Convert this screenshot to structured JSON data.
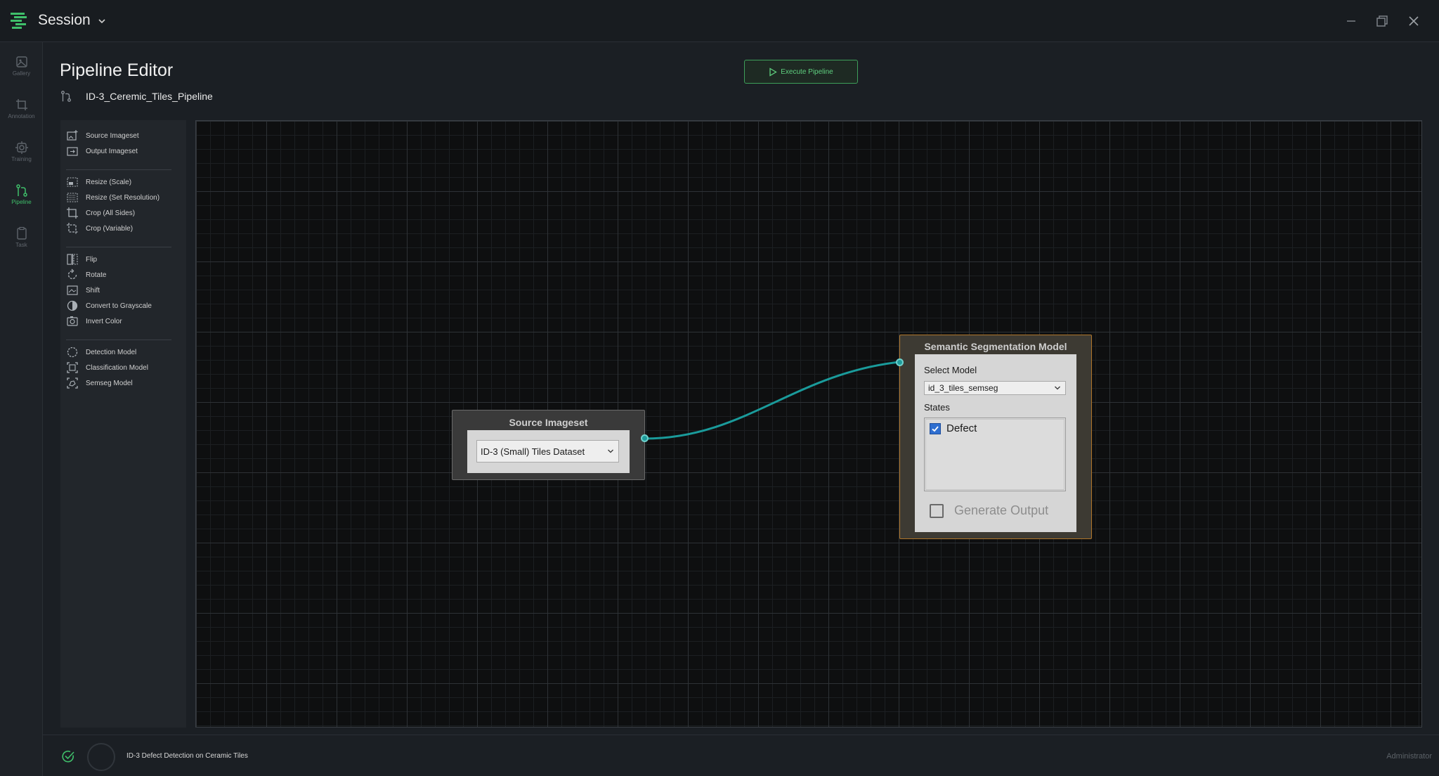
{
  "titlebar": {
    "session_label": "Session",
    "icons": [
      "app-logo",
      "chevron-down-icon",
      "minimize-icon",
      "restore-icon",
      "close-icon"
    ]
  },
  "nav_rail": {
    "items": [
      {
        "label": "Gallery",
        "icon": "gallery-icon",
        "active": false
      },
      {
        "label": "Annotation",
        "icon": "crop-icon",
        "active": false
      },
      {
        "label": "Training",
        "icon": "training-icon",
        "active": false
      },
      {
        "label": "Pipeline",
        "icon": "pipeline-icon",
        "active": true
      },
      {
        "label": "Task",
        "icon": "clipboard-icon",
        "active": false
      }
    ]
  },
  "header": {
    "title": "Pipeline Editor",
    "pipeline_name": "ID-3_Ceremic_Tiles_Pipeline",
    "execute_label": "Execute Pipeline"
  },
  "palette": {
    "items": [
      {
        "label": "Source Imageset",
        "icon": "image-plus-icon"
      },
      {
        "label": "Output Imageset",
        "icon": "image-out-icon"
      },
      {
        "label": "Resize (Scale)",
        "icon": "resize-scale-icon"
      },
      {
        "label": "Resize (Set Resolution)",
        "icon": "resize-resolution-icon"
      },
      {
        "label": "Crop (All Sides)",
        "icon": "crop-icon"
      },
      {
        "label": "Crop (Variable)",
        "icon": "crop-variable-icon"
      },
      {
        "label": "Flip",
        "icon": "flip-icon"
      },
      {
        "label": "Rotate",
        "icon": "rotate-icon"
      },
      {
        "label": "Shift",
        "icon": "shift-icon"
      },
      {
        "label": "Convert to Grayscale",
        "icon": "grayscale-icon"
      },
      {
        "label": "Invert Color",
        "icon": "invert-color-icon"
      },
      {
        "label": "Detection Model",
        "icon": "detection-icon"
      },
      {
        "label": "Classification Model",
        "icon": "classification-icon"
      },
      {
        "label": "Semseg Model",
        "icon": "semseg-icon"
      }
    ]
  },
  "canvas": {
    "source_node": {
      "title": "Source Imageset",
      "dataset": "ID-3 (Small) Tiles Dataset"
    },
    "seg_node": {
      "title": "Semantic Segmentation Model",
      "select_model_label": "Select Model",
      "model": "id_3_tiles_semseg",
      "states_label": "States",
      "states": [
        {
          "label": "Defect",
          "checked": true
        }
      ],
      "generate_output_label": "Generate Output",
      "generate_output_checked": false
    },
    "connection_color": "#1a9b9b"
  },
  "status": {
    "task": "ID-3 Defect Detection on Ceramic Tiles",
    "user": "Administrator"
  },
  "colors": {
    "accent": "#3fbf6a",
    "seg_border": "#b0762a",
    "wire": "#1a9b9b"
  }
}
